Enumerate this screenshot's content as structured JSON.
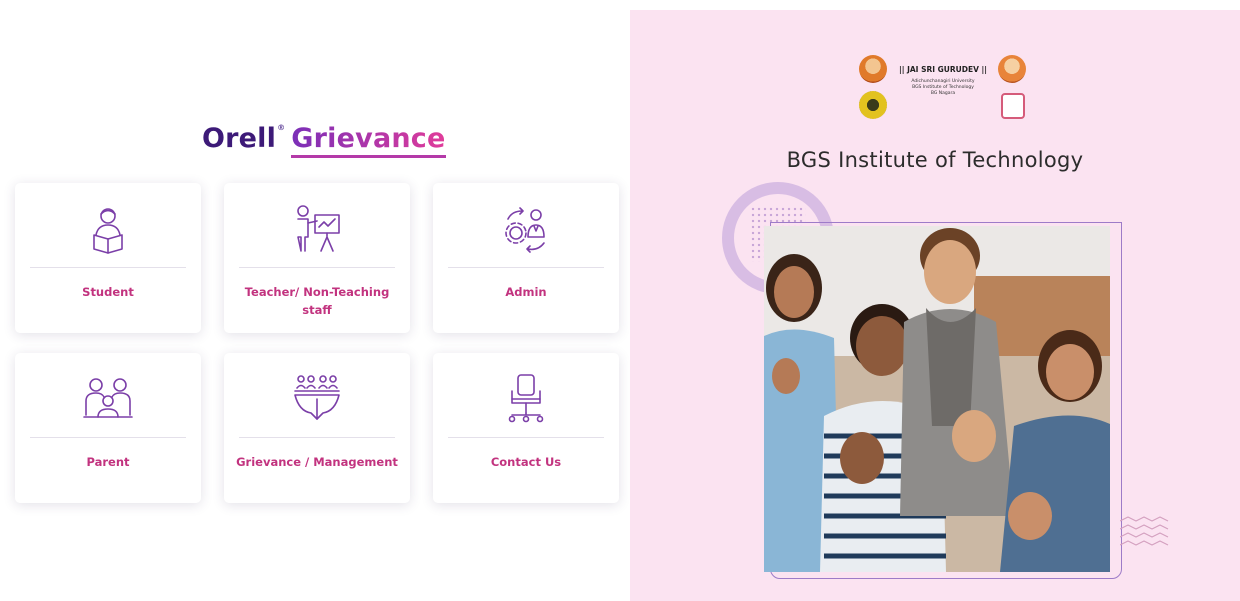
{
  "brand": {
    "name_part1": "Orell",
    "trademark": "®",
    "name_part2": "Grievance"
  },
  "cards": [
    {
      "id": "student",
      "label": "Student",
      "icon": "student-reading-icon"
    },
    {
      "id": "teacher",
      "label": "Teacher/ Non-Teaching staff",
      "icon": "teacher-board-icon"
    },
    {
      "id": "admin",
      "label": "Admin",
      "icon": "admin-gear-person-icon"
    },
    {
      "id": "parent",
      "label": "Parent",
      "icon": "parent-family-icon"
    },
    {
      "id": "management",
      "label": "Grievance / Management",
      "icon": "management-meeting-icon"
    },
    {
      "id": "contact",
      "label": "Contact Us",
      "icon": "office-chair-icon"
    }
  ],
  "header": {
    "motto": "|| JAI SRI GURUDEV ||",
    "sub_lines": [
      "Adichunchanagiri University",
      "BGS Institute of Technology",
      "BG Nagara"
    ]
  },
  "institute_title": "BGS Institute of Technology",
  "colors": {
    "brand_dark": "#3d1a78",
    "brand_gradient_start": "#7a2fb8",
    "brand_gradient_end": "#e13c9a",
    "card_label": "#c2337f",
    "icon_stroke": "#7b3fa8",
    "right_panel_bg": "#fbe3f1"
  }
}
